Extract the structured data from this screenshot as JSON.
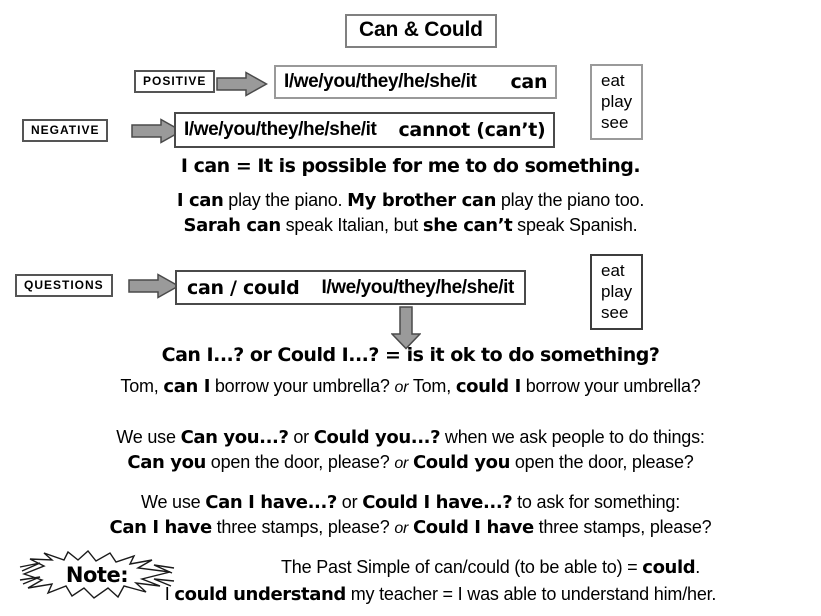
{
  "title": "Can & Could",
  "labels": {
    "positive": "POSITIVE",
    "negative": "NEGATIVE",
    "questions": "QUESTIONS"
  },
  "icons": {
    "arrow_right": "arrow-right-icon",
    "arrow_down": "arrow-down-icon",
    "starburst": "starburst-icon"
  },
  "patterns": {
    "positive": {
      "subject": "I/we/you/they/he/she/it",
      "modal": "can"
    },
    "negative": {
      "subject": "I/we/you/they/he/she/it",
      "modal": "cannot (can’t)"
    },
    "question": {
      "modal": "can / could",
      "subject": "I/we/you/they/he/she/it"
    }
  },
  "verbs": [
    "eat",
    "play",
    "see"
  ],
  "meaning": {
    "headline": "I can = It is possible for me to do something.",
    "examples": [
      [
        {
          "t": "I can",
          "b": true
        },
        {
          "t": " play the piano. ",
          "b": false
        },
        {
          "t": "My brother can",
          "b": true
        },
        {
          "t": " play the piano too.",
          "b": false
        }
      ],
      [
        {
          "t": "Sarah can",
          "b": true
        },
        {
          "t": " speak Italian, but ",
          "b": false
        },
        {
          "t": "she can’t",
          "b": true
        },
        {
          "t": " speak Spanish.",
          "b": false
        }
      ]
    ]
  },
  "permission": {
    "headline": "Can I...? or Could I...? = is it ok to do something?",
    "example": [
      {
        "t": "Tom, ",
        "b": false
      },
      {
        "t": "can I",
        "b": true
      },
      {
        "t": " borrow your umbrella? ",
        "b": false
      },
      {
        "t": "or",
        "i": true
      },
      {
        "t": " Tom, ",
        "b": false
      },
      {
        "t": "could I",
        "b": true
      },
      {
        "t": " borrow your umbrella?",
        "b": false
      }
    ]
  },
  "requests": {
    "rule": [
      {
        "t": "We use ",
        "b": false
      },
      {
        "t": "Can you...?",
        "b": true
      },
      {
        "t": " or ",
        "b": false
      },
      {
        "t": "Could you...?",
        "b": true
      },
      {
        "t": " when we ask people to do things:",
        "b": false
      }
    ],
    "example": [
      {
        "t": "Can you",
        "b": true
      },
      {
        "t": " open the door, please? ",
        "b": false
      },
      {
        "t": "or",
        "i": true
      },
      {
        "t": " ",
        "b": false
      },
      {
        "t": "Could you",
        "b": true
      },
      {
        "t": " open the door, please?",
        "b": false
      }
    ]
  },
  "asking": {
    "rule": [
      {
        "t": "We use ",
        "b": false
      },
      {
        "t": "Can I have...?",
        "b": true
      },
      {
        "t": " or ",
        "b": false
      },
      {
        "t": "Could I have...?",
        "b": true
      },
      {
        "t": " to ask for something:",
        "b": false
      }
    ],
    "example": [
      {
        "t": "Can I have",
        "b": true
      },
      {
        "t": " three stamps, please? ",
        "b": false
      },
      {
        "t": "or",
        "i": true
      },
      {
        "t": " ",
        "b": false
      },
      {
        "t": "Could I have",
        "b": true
      },
      {
        "t": " three stamps, please?",
        "b": false
      }
    ]
  },
  "note": {
    "label": "Note:",
    "lines": [
      [
        {
          "t": "The Past Simple of can/could (to be able to) = ",
          "b": false
        },
        {
          "t": "could",
          "b": true
        },
        {
          "t": ".",
          "b": false
        }
      ],
      [
        {
          "t": "I ",
          "b": false
        },
        {
          "t": "could understand",
          "b": true
        },
        {
          "t": " my teacher = I was able to understand him/her.",
          "b": false
        }
      ]
    ]
  },
  "colors": {
    "arrow_fill": "#9a9a9a",
    "arrow_stroke": "#4a4a4a",
    "box_border": "#999999",
    "text": "#000000",
    "background": "#ffffff"
  }
}
